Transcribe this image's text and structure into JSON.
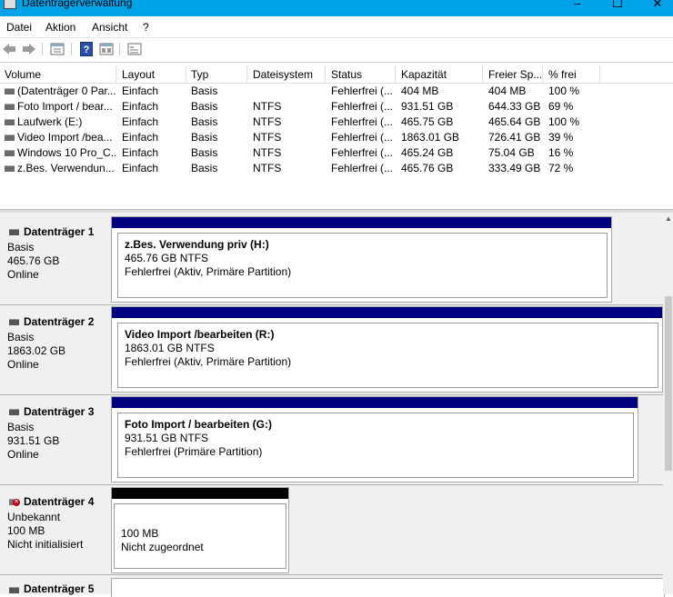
{
  "window": {
    "title": "Datenträgerverwaltung",
    "minimize": "–",
    "maximize": "☐",
    "close": "✕"
  },
  "menu": [
    "Datei",
    "Aktion",
    "Ansicht",
    "?"
  ],
  "toolbar": {
    "icons": [
      "back-arrow-icon",
      "forward-arrow-icon",
      "properties-icon",
      "help-icon",
      "view-icon",
      "console-icon"
    ]
  },
  "columns": [
    "Volume",
    "Layout",
    "Typ",
    "Dateisystem",
    "Status",
    "Kapazität",
    "Freier Sp...",
    "% frei"
  ],
  "volumes": [
    {
      "volume": "(Datenträger 0 Par...",
      "layout": "Einfach",
      "typ": "Basis",
      "fs": "",
      "status": "Fehlerfrei (...",
      "cap": "404 MB",
      "free": "404 MB",
      "pct": "100 %"
    },
    {
      "volume": "Foto Import / bear...",
      "layout": "Einfach",
      "typ": "Basis",
      "fs": "NTFS",
      "status": "Fehlerfrei (...",
      "cap": "931.51 GB",
      "free": "644.33 GB",
      "pct": "69 %"
    },
    {
      "volume": "Laufwerk (E:)",
      "layout": "Einfach",
      "typ": "Basis",
      "fs": "NTFS",
      "status": "Fehlerfrei (...",
      "cap": "465.75 GB",
      "free": "465.64 GB",
      "pct": "100 %"
    },
    {
      "volume": "Video Import /bea...",
      "layout": "Einfach",
      "typ": "Basis",
      "fs": "NTFS",
      "status": "Fehlerfrei (...",
      "cap": "1863.01 GB",
      "free": "726.41 GB",
      "pct": "39 %"
    },
    {
      "volume": "Windows 10 Pro_C...",
      "layout": "Einfach",
      "typ": "Basis",
      "fs": "NTFS",
      "status": "Fehlerfrei (...",
      "cap": "465.24 GB",
      "free": "75.04 GB",
      "pct": "16 %"
    },
    {
      "volume": "z.Bes. Verwendun...",
      "layout": "Einfach",
      "typ": "Basis",
      "fs": "NTFS",
      "status": "Fehlerfrei (...",
      "cap": "465.76 GB",
      "free": "333.49 GB",
      "pct": "72 %"
    }
  ],
  "disks": [
    {
      "name": "Datenträger 1",
      "type": "Basis",
      "size": "465.76 GB",
      "state": "Online",
      "partition": {
        "title": "z.Bes. Verwendung priv  (H:)",
        "line2": "465.76 GB NTFS",
        "line3": "Fehlerfrei (Aktiv, Primäre Partition)",
        "bar_color": "#000080"
      }
    },
    {
      "name": "Datenträger 2",
      "type": "Basis",
      "size": "1863.02 GB",
      "state": "Online",
      "partition": {
        "title": "Video Import /bearbeiten  (R:)",
        "line2": "1863.01 GB NTFS",
        "line3": "Fehlerfrei (Aktiv, Primäre Partition)",
        "bar_color": "#000080"
      }
    },
    {
      "name": "Datenträger 3",
      "type": "Basis",
      "size": "931.51 GB",
      "state": "Online",
      "partition": {
        "title": "Foto Import / bearbeiten  (G:)",
        "line2": "931.51 GB NTFS",
        "line3": "Fehlerfrei (Primäre Partition)",
        "bar_color": "#000080"
      }
    },
    {
      "name": "Datenträger 4",
      "type": "Unbekannt",
      "size": "100 MB",
      "state": "Nicht initialisiert",
      "partition": {
        "title": "",
        "line2": "100 MB",
        "line3": "Nicht zugeordnet",
        "bar_color": "#000000"
      }
    },
    {
      "name": "Datenträger 5"
    }
  ]
}
